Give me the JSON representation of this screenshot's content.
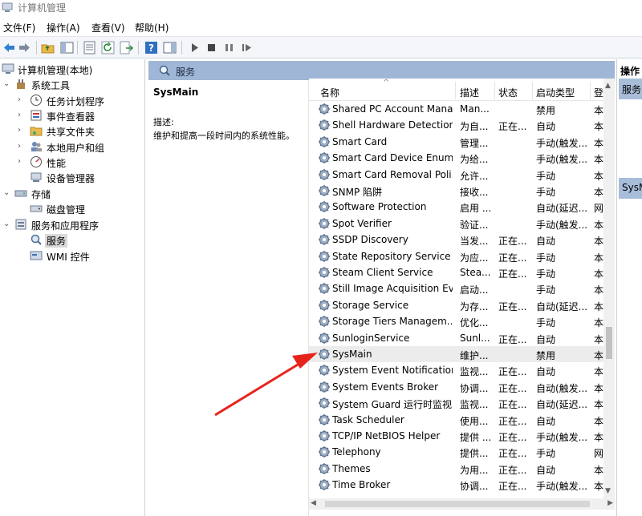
{
  "window": {
    "title": "计算机管理"
  },
  "menu": {
    "items": [
      "文件(F)",
      "操作(A)",
      "查看(V)",
      "帮助(H)"
    ]
  },
  "tree": {
    "root": "计算机管理(本地)",
    "system_tools": "系统工具",
    "task_scheduler": "任务计划程序",
    "event_viewer": "事件查看器",
    "shared_folders": "共享文件夹",
    "local_users": "本地用户和组",
    "performance": "性能",
    "device_manager": "设备管理器",
    "storage": "存储",
    "disk_management": "磁盘管理",
    "services_apps": "服务和应用程序",
    "services": "服务",
    "wmi": "WMI 控件"
  },
  "panel": {
    "header": "服务"
  },
  "detail": {
    "name": "SysMain",
    "desc_label": "描述:",
    "desc_text": "维护和提高一段时间内的系统性能。"
  },
  "columns": {
    "name": "名称",
    "desc": "描述",
    "status": "状态",
    "startup": "启动类型",
    "logon": "登"
  },
  "services": [
    {
      "name": "Shared PC Account Mana...",
      "desc": "Man...",
      "status": "",
      "startup": "禁用",
      "logon": "本"
    },
    {
      "name": "Shell Hardware Detection",
      "desc": "为自...",
      "status": "正在...",
      "startup": "自动",
      "logon": "本"
    },
    {
      "name": "Smart Card",
      "desc": "管理...",
      "status": "",
      "startup": "手动(触发...",
      "logon": "本"
    },
    {
      "name": "Smart Card Device Enum...",
      "desc": "为给...",
      "status": "",
      "startup": "手动(触发...",
      "logon": "本"
    },
    {
      "name": "Smart Card Removal Poli...",
      "desc": "允许...",
      "status": "",
      "startup": "手动",
      "logon": "本"
    },
    {
      "name": "SNMP 陷阱",
      "desc": "接收...",
      "status": "",
      "startup": "手动",
      "logon": "本"
    },
    {
      "name": "Software Protection",
      "desc": "启用 ...",
      "status": "",
      "startup": "自动(延迟...",
      "logon": "网"
    },
    {
      "name": "Spot Verifier",
      "desc": "验证...",
      "status": "",
      "startup": "手动(触发...",
      "logon": "本"
    },
    {
      "name": "SSDP Discovery",
      "desc": "当发...",
      "status": "正在...",
      "startup": "自动",
      "logon": "本"
    },
    {
      "name": "State Repository Service",
      "desc": "为应...",
      "status": "正在...",
      "startup": "手动",
      "logon": "本"
    },
    {
      "name": "Steam Client Service",
      "desc": "Stea...",
      "status": "正在...",
      "startup": "手动",
      "logon": "本"
    },
    {
      "name": "Still Image Acquisition Ev...",
      "desc": "启动...",
      "status": "",
      "startup": "手动",
      "logon": "本"
    },
    {
      "name": "Storage Service",
      "desc": "为存...",
      "status": "正在...",
      "startup": "自动(延迟...",
      "logon": "本"
    },
    {
      "name": "Storage Tiers Managem...",
      "desc": "优化...",
      "status": "",
      "startup": "手动",
      "logon": "本"
    },
    {
      "name": "SunloginService",
      "desc": "Sunl...",
      "status": "正在...",
      "startup": "自动",
      "logon": "本"
    },
    {
      "name": "SysMain",
      "desc": "维护...",
      "status": "",
      "startup": "禁用",
      "logon": "本"
    },
    {
      "name": "System Event Notification...",
      "desc": "监视...",
      "status": "正在...",
      "startup": "自动",
      "logon": "本"
    },
    {
      "name": "System Events Broker",
      "desc": "协调...",
      "status": "正在...",
      "startup": "自动(触发...",
      "logon": "本"
    },
    {
      "name": "System Guard 运行时监视...",
      "desc": "监视...",
      "status": "正在...",
      "startup": "自动(延迟...",
      "logon": "本"
    },
    {
      "name": "Task Scheduler",
      "desc": "使用...",
      "status": "正在...",
      "startup": "自动",
      "logon": "本"
    },
    {
      "name": "TCP/IP NetBIOS Helper",
      "desc": "提供 ...",
      "status": "正在...",
      "startup": "手动(触发...",
      "logon": "本"
    },
    {
      "name": "Telephony",
      "desc": "提供...",
      "status": "正在...",
      "startup": "手动",
      "logon": "网"
    },
    {
      "name": "Themes",
      "desc": "为用...",
      "status": "正在...",
      "startup": "自动",
      "logon": "本"
    },
    {
      "name": "Time Broker",
      "desc": "协调...",
      "status": "正在...",
      "startup": "手动(触发...",
      "logon": "本"
    }
  ],
  "actions": {
    "header": "操作",
    "item1": "服务",
    "item2": "SysMain"
  },
  "colors": {
    "selection_row": "#ececec",
    "panel_header": "#9fb6d6",
    "annotation_arrow": "#e8231c"
  }
}
